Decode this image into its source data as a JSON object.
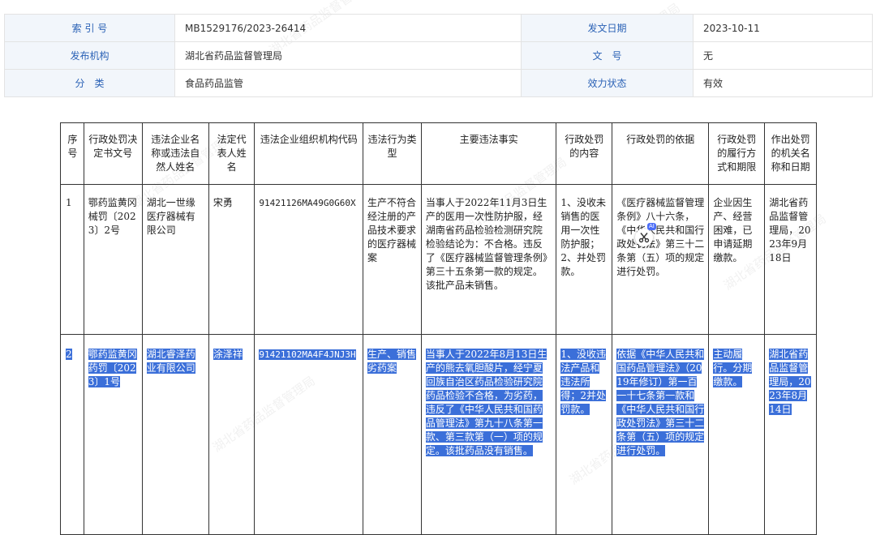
{
  "meta": {
    "index_label": "索 引 号",
    "index_value": "MB1529176/2023-26414",
    "date_label": "发文日期",
    "date_value": "2023-10-11",
    "org_label": "发布机构",
    "org_value": "湖北省药品监督管理局",
    "docno_label": "文　号",
    "docno_value": "无",
    "category_label": "分　类",
    "category_value": "食品药品监管",
    "status_label": "效力状态",
    "status_value": "有效"
  },
  "table": {
    "headers": [
      "序号",
      "行政处罚决定书文号",
      "违法企业名称或违法自然人姓名",
      "法定代表人姓名",
      "违法企业组织机构代码",
      "违法行为类型",
      "主要违法事实",
      "行政处罚的内容",
      "行政处罚的依据",
      "行政处罚的履行方式和期限",
      "作出处罚的机关名称和日期"
    ],
    "rows": [
      {
        "no": "1",
        "doc_no": "鄂药监黄冈械罚〔2023〕2号",
        "company": "湖北一世缘医疗器械有限公司",
        "legal_rep": "宋勇",
        "org_code": "91421126MA49G0G60X",
        "violation_type": "生产不符合经注册的产品技术要求的医疗器械案",
        "facts": "当事人于2022年11月3日生产的医用一次性防护服，经湖南省药品检验检测研究院检验结论为：不合格。违反了《医疗器械监督管理条例》第三十五条第一款的规定。该批产品未销售。",
        "penalty": "1、没收未销售的医用一次性防护服；2、并处罚款。",
        "basis": "《医疗器械监督管理条例》八十六条，《中华人民共和国行政处罚法》第三十二条第（五）项的规定进行处罚。",
        "execution": "企业因生产、经营困难，已申请延期缴款。",
        "authority": "湖北省药品监督管理局，2023年9月18日"
      },
      {
        "no": "2",
        "doc_no": "鄂药监黄冈药罚〔2023〕1号",
        "company": "湖北睿泽药业有限公司",
        "legal_rep": "涂泽祥",
        "org_code": "91421102MA4F4JNJ3H",
        "violation_type": "生产、销售劣药案",
        "facts": "当事人于2022年8月13日生产的熊去氧胆酸片，经宁夏回族自治区药品检验研究院药品检验不合格，为劣药，违反了《中华人民共和国药品管理法》第九十八条第一款、第三款第（一）项的规定。该批药品没有销售。",
        "penalty": "1、没收违法产品和违法所得；2并处罚款。",
        "basis": "依据《中华人民共和国药品管理法》（2019年修订）第一百一十七条第一款和《中华人民共和国行政处罚法》第三十二条第（五）项的规定进行处罚。",
        "execution": "主动履行。分期缴款。",
        "authority": "湖北省药品监督管理局，2023年8月14日"
      }
    ]
  },
  "watermark_text": "湖北省药品监督管理局",
  "tool": {
    "badge": "AI",
    "icon": "scissors-icon"
  }
}
